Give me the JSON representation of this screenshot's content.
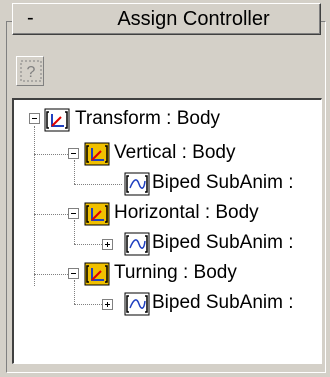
{
  "rollout": {
    "title": "Assign Controller",
    "collapse_glyph": "-"
  },
  "toolbar": {
    "help_label": "?",
    "help_icon": "help-icon"
  },
  "tree": {
    "nodes": [
      {
        "label": "Transform : Body",
        "icon": "transform-controller-icon",
        "expander": "minus"
      },
      {
        "label": "Vertical : Body",
        "icon": "position-controller-icon",
        "expander": "minus"
      },
      {
        "label": "Biped SubAnim :",
        "icon": "curve-controller-icon",
        "expander": "none"
      },
      {
        "label": "Horizontal : Body",
        "icon": "position-controller-icon",
        "expander": "minus"
      },
      {
        "label": "Biped SubAnim :",
        "icon": "curve-controller-icon",
        "expander": "plus"
      },
      {
        "label": "Turning : Body",
        "icon": "rotation-controller-icon",
        "expander": "minus"
      },
      {
        "label": "Biped SubAnim :",
        "icon": "curve-controller-icon",
        "expander": "plus"
      }
    ]
  },
  "colors": {
    "panel": "#d4d0c8",
    "tree_bg": "#ffffff",
    "icon_yellow": "#f0c000",
    "icon_accent_red": "#e00000",
    "icon_accent_blue": "#2040c0"
  }
}
